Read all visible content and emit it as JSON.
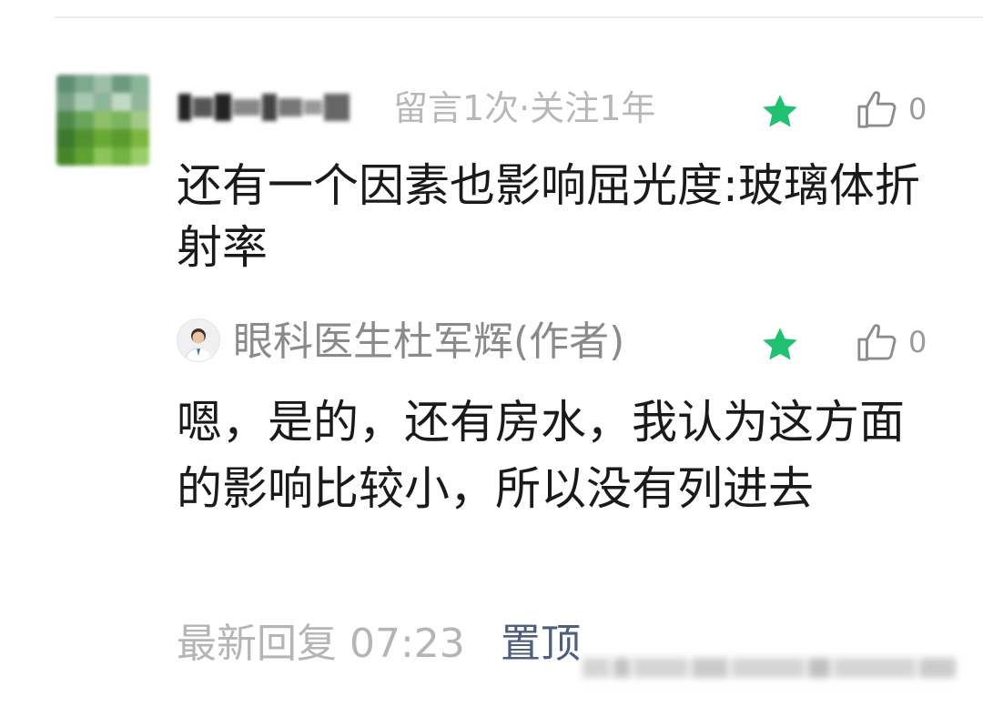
{
  "comment": {
    "meta": "留言1次·关注1年",
    "text": "还有一个因素也影响屈光度:玻璃体折射率",
    "like_count": "0"
  },
  "reply": {
    "author": "眼科医生杜军辉(作者)",
    "text": "嗯，是的，还有房水，我认为这方面的影响比较小，所以没有列进去",
    "like_count": "0",
    "time": "最新回复 07:23",
    "pin_label": "置顶"
  },
  "icons": {
    "star": "star-icon",
    "like": "thumbs-up-icon"
  },
  "colors": {
    "star": "#21c172",
    "pin_link": "#4e5f7d",
    "meta_text": "#b8b8b8"
  }
}
